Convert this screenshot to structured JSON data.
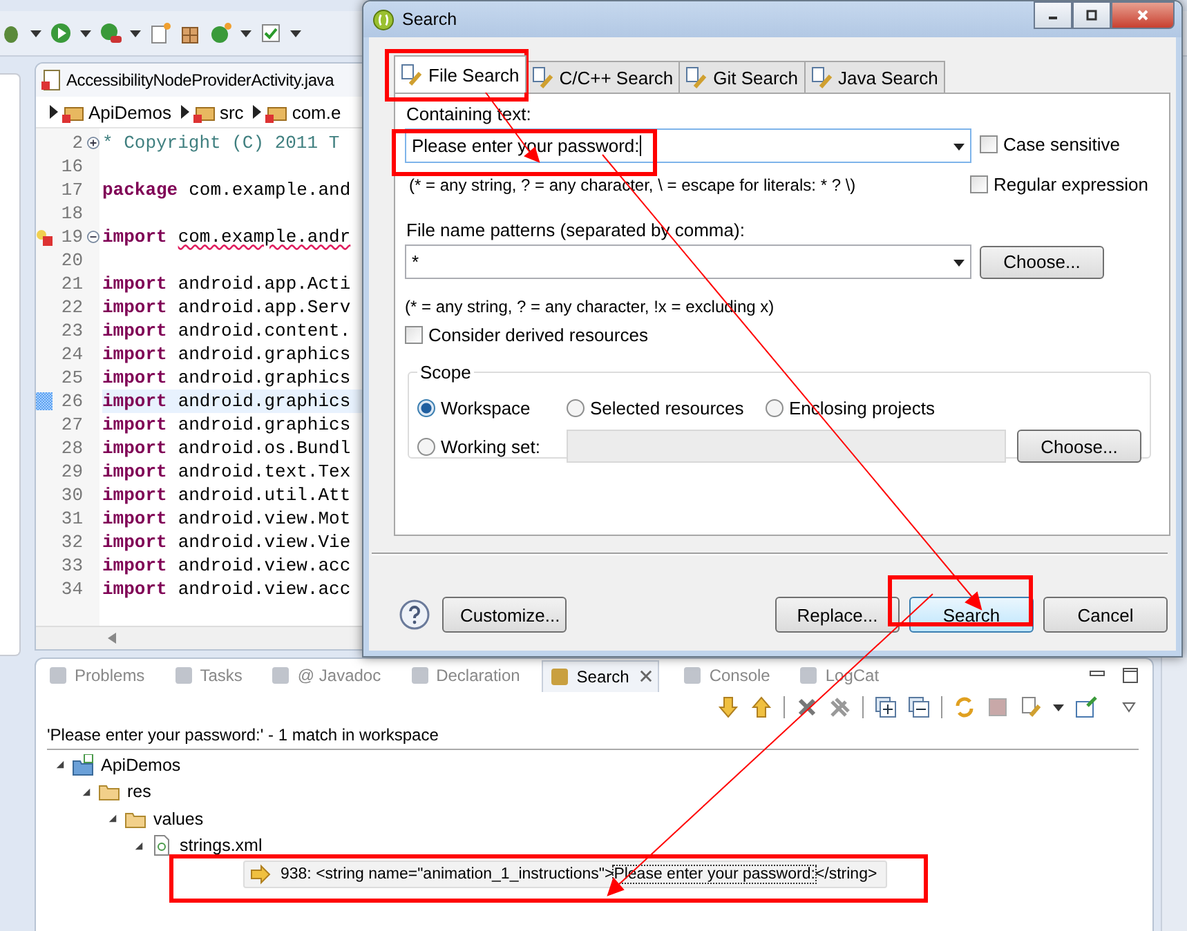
{
  "editor": {
    "tab": "AccessibilityNodeProviderActivity.java",
    "breadcrumb": [
      "ApiDemos",
      "src",
      "com.e"
    ],
    "lines": [
      {
        "number": "2",
        "kind": "comment",
        "text": "* Copyright (C) 2011 T",
        "folded": true
      },
      {
        "number": "16",
        "kind": "blank"
      },
      {
        "number": "17",
        "kind": "code",
        "keyword": "package",
        "text": "com.example.and"
      },
      {
        "number": "18",
        "kind": "blank"
      },
      {
        "number": "19",
        "kind": "code",
        "keyword": "import",
        "text": "com.example.andr",
        "folded": false,
        "error": true
      },
      {
        "number": "20",
        "kind": "blank"
      },
      {
        "number": "21",
        "kind": "code",
        "keyword": "import",
        "text": "android.app.Acti"
      },
      {
        "number": "22",
        "kind": "code",
        "keyword": "import",
        "text": "android.app.Serv"
      },
      {
        "number": "23",
        "kind": "code",
        "keyword": "import",
        "text": "android.content."
      },
      {
        "number": "24",
        "kind": "code",
        "keyword": "import",
        "text": "android.graphics"
      },
      {
        "number": "25",
        "kind": "code",
        "keyword": "import",
        "text": "android.graphics"
      },
      {
        "number": "26",
        "kind": "code",
        "keyword": "import",
        "text": "android.graphics",
        "current": true
      },
      {
        "number": "27",
        "kind": "code",
        "keyword": "import",
        "text": "android.graphics"
      },
      {
        "number": "28",
        "kind": "code",
        "keyword": "import",
        "text": "android.os.Bundl"
      },
      {
        "number": "29",
        "kind": "code",
        "keyword": "import",
        "text": "android.text.Tex"
      },
      {
        "number": "30",
        "kind": "code",
        "keyword": "import",
        "text": "android.util.Att"
      },
      {
        "number": "31",
        "kind": "code",
        "keyword": "import",
        "text": "android.view.Mot"
      },
      {
        "number": "32",
        "kind": "code",
        "keyword": "import",
        "text": "android.view.Vie"
      },
      {
        "number": "33",
        "kind": "code",
        "keyword": "import",
        "text": "android.view.acc"
      },
      {
        "number": "34",
        "kind": "code",
        "keyword": "import",
        "text": "android.view.acc"
      }
    ]
  },
  "bottom_panel": {
    "tabs": [
      {
        "label": "Problems",
        "selected": false
      },
      {
        "label": "Tasks",
        "selected": false
      },
      {
        "label": "@ Javadoc",
        "selected": false
      },
      {
        "label": "Declaration",
        "selected": false
      },
      {
        "label": "Search",
        "selected": true
      },
      {
        "label": "Console",
        "selected": false
      },
      {
        "label": "LogCat",
        "selected": false
      }
    ],
    "summary": "'Please enter your password:' - 1 match in workspace",
    "tree": [
      {
        "label": "ApiDemos",
        "kind": "project",
        "expanded": true,
        "children": [
          {
            "label": "res",
            "kind": "folder",
            "expanded": true,
            "children": [
              {
                "label": "values",
                "kind": "folder",
                "expanded": true,
                "children": [
                  {
                    "label": "strings.xml",
                    "kind": "file",
                    "expanded": true,
                    "children": [
                      {
                        "kind": "match",
                        "line": "938:",
                        "text_before": "<string name=\"animation_1_instructions\">",
                        "match": "Please enter your password:",
                        "text_after": "</string>"
                      }
                    ]
                  }
                ]
              }
            ]
          }
        ]
      }
    ]
  },
  "dialog": {
    "title": "Search",
    "tabs": [
      {
        "label": "File Search",
        "selected": true
      },
      {
        "label": "C/C++ Search",
        "selected": false
      },
      {
        "label": "Git Search",
        "selected": false
      },
      {
        "label": "Java Search",
        "selected": false
      }
    ],
    "containing_text": {
      "label": "Containing text:",
      "value": "Please enter your password:",
      "hint": "(* = any string, ? = any character, \\ = escape for literals: * ? \\)"
    },
    "options": [
      {
        "label": "Case sensitive",
        "checked": false
      },
      {
        "label": "Regular expression",
        "checked": false
      }
    ],
    "file_patterns": {
      "label": "File name patterns (separated by comma):",
      "value": "*",
      "button": "Choose...",
      "hint": "(* = any string, ? = any character, !x = excluding x)"
    },
    "derived": {
      "label": "Consider derived resources",
      "checked": false
    },
    "scope": {
      "title": "Scope",
      "options": [
        {
          "label": "Workspace",
          "selected": true
        },
        {
          "label": "Selected resources",
          "selected": false
        },
        {
          "label": "Enclosing projects",
          "selected": false
        },
        {
          "label": "Working set:",
          "selected": false
        }
      ],
      "button": "Choose..."
    },
    "buttons": [
      {
        "label": "Customize...",
        "default": false
      },
      {
        "label": "Replace...",
        "default": false
      },
      {
        "label": "Search",
        "default": true
      },
      {
        "label": "Cancel",
        "default": false
      }
    ]
  }
}
